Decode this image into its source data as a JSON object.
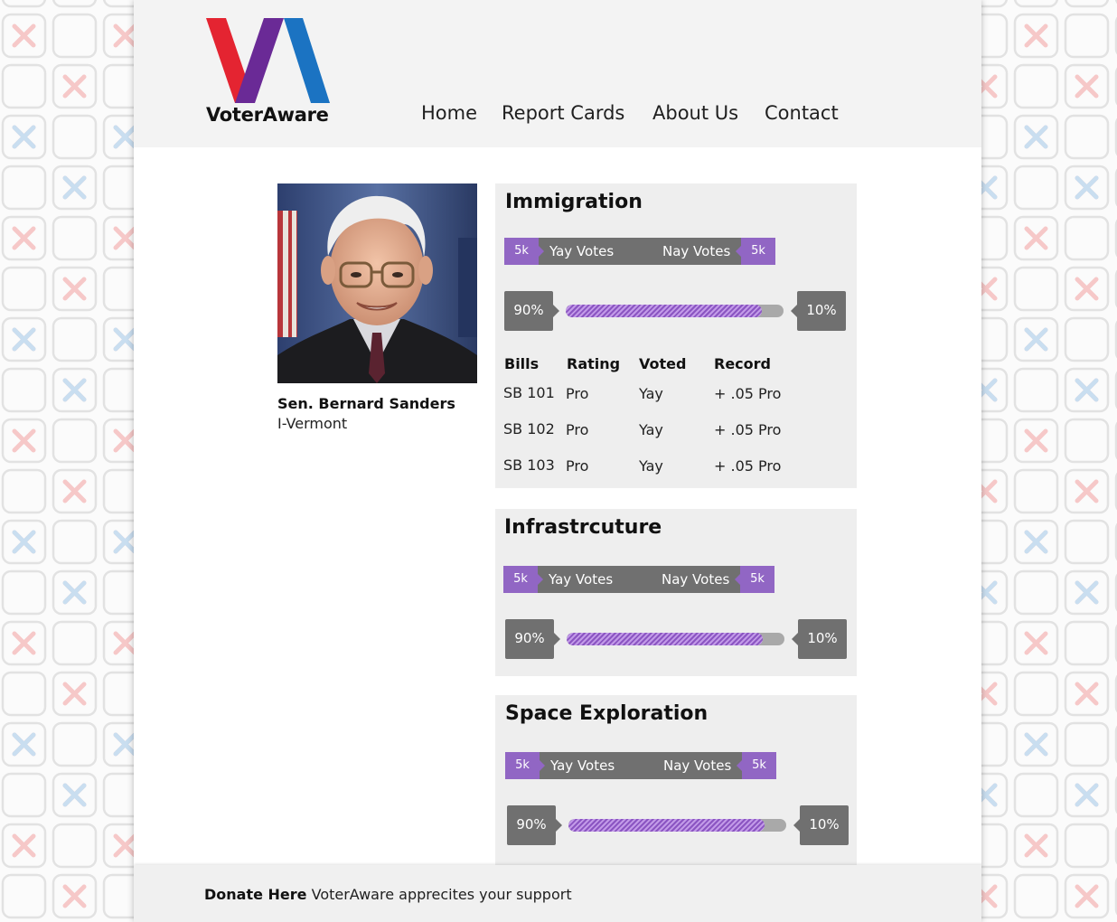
{
  "brand": {
    "name": "VoterAware",
    "colors": {
      "red": "#e42431",
      "purple": "#6a2a96",
      "blue": "#1b73c2",
      "accent": "#9166c4",
      "pill": "#707070"
    }
  },
  "nav": [
    "Home",
    "Report Cards",
    "About Us",
    "Contact"
  ],
  "politician": {
    "name": "Sen. Bernard Sanders",
    "affiliation": "I-Vermont"
  },
  "bill_columns": [
    "Bills",
    "Rating",
    "Voted",
    "Record"
  ],
  "issues": [
    {
      "title": "Immigration",
      "yay_count": "5k",
      "yay_label": "Yay Votes",
      "nay_label": "Nay Votes",
      "nay_count": "5k",
      "pro_pct": "90%",
      "con_pct": "10%",
      "pro_fraction": 0.9,
      "bills": [
        {
          "bill": "SB 101",
          "rating": "Pro",
          "voted": "Yay",
          "record": "+ .05 Pro"
        },
        {
          "bill": "SB 102",
          "rating": "Pro",
          "voted": "Yay",
          "record": "+ .05 Pro"
        },
        {
          "bill": "SB 103",
          "rating": "Pro",
          "voted": "Yay",
          "record": "+ .05 Pro"
        }
      ]
    },
    {
      "title": "Infrastrcuture",
      "yay_count": "5k",
      "yay_label": "Yay Votes",
      "nay_label": "Nay Votes",
      "nay_count": "5k",
      "pro_pct": "90%",
      "con_pct": "10%",
      "pro_fraction": 0.9
    },
    {
      "title": "Space Exploration",
      "yay_count": "5k",
      "yay_label": "Yay Votes",
      "nay_label": "Nay Votes",
      "nay_count": "5k",
      "pro_pct": "90%",
      "con_pct": "10%",
      "pro_fraction": 0.9
    }
  ],
  "footer": {
    "link": "Donate Here",
    "message": "VoterAware apprecites your support"
  }
}
